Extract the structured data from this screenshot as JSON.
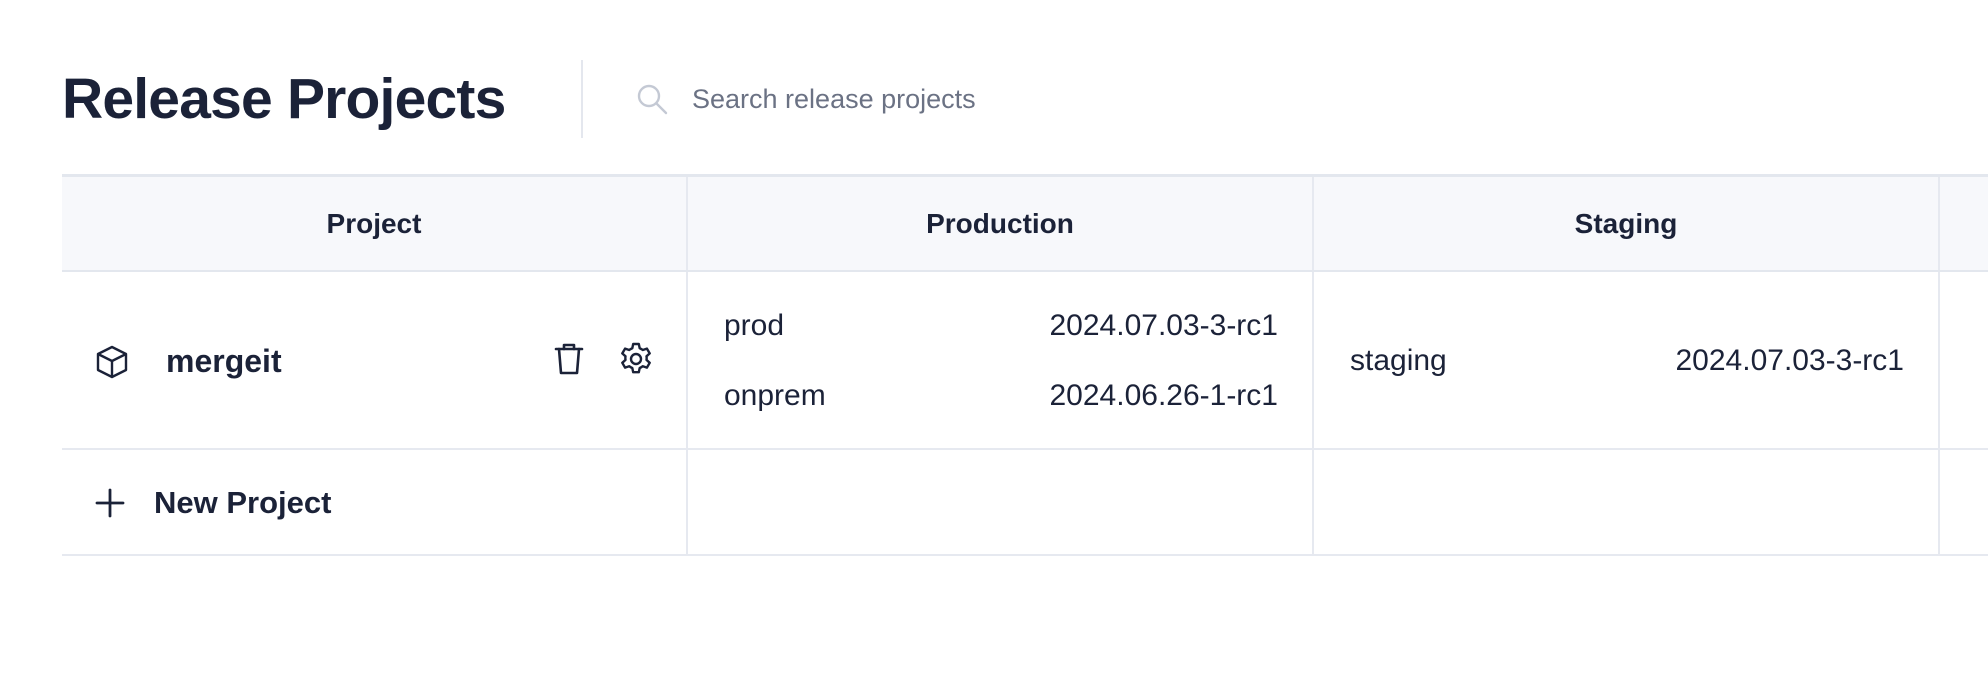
{
  "header": {
    "title": "Release Projects",
    "search_placeholder": "Search release projects"
  },
  "table": {
    "columns": [
      "Project",
      "Production",
      "Staging"
    ],
    "rows": [
      {
        "project": "mergeit",
        "production": [
          {
            "name": "prod",
            "version": "2024.07.03-3-rc1"
          },
          {
            "name": "onprem",
            "version": "2024.06.26-1-rc1"
          }
        ],
        "staging": [
          {
            "name": "staging",
            "version": "2024.07.03-3-rc1"
          }
        ]
      }
    ],
    "new_project_label": "New Project"
  },
  "icons": {
    "search": "search-icon",
    "project": "cube-icon",
    "delete": "trash-icon",
    "settings": "gear-icon",
    "add": "plus-icon"
  },
  "colors": {
    "text": "#1b2238",
    "muted": "#6b7284",
    "header_bg": "#f7f8fb",
    "border": "#e6e9f0"
  }
}
